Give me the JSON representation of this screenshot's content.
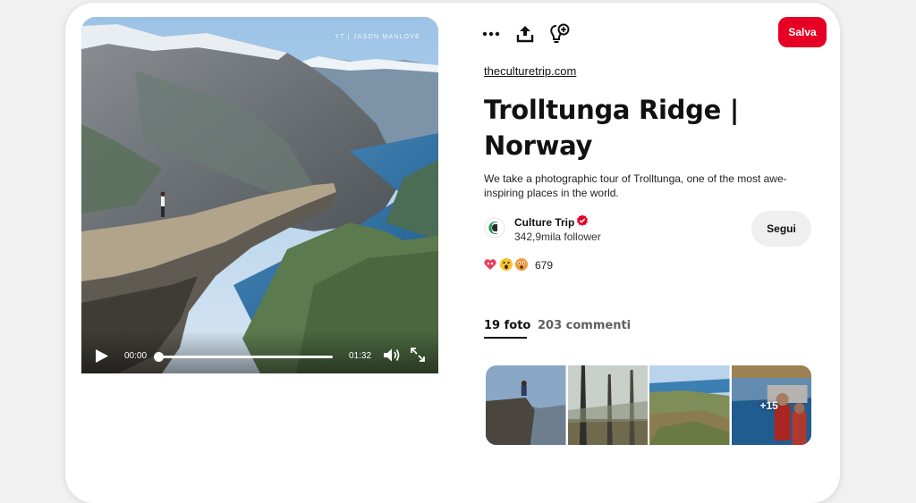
{
  "video": {
    "watermark": "YT | JASON MANLOVE",
    "time_current": "00:00",
    "time_total": "01:32",
    "progress": 0
  },
  "toolbar": {
    "more_icon": "more-horizontal-icon",
    "share_icon": "share-upload-icon",
    "idea_icon": "lightbulb-plus-icon",
    "save_label": "Salva"
  },
  "pin": {
    "source": "theculturetrip.com",
    "title": "Trolltunga Ridge | Norway",
    "description": "We take a photographic tour of Trolltunga, one of the most awe-inspiring places in the world."
  },
  "author": {
    "name": "Culture Trip",
    "followers": "342,9mila follower",
    "follow_label": "Segui"
  },
  "reactions": {
    "icons": [
      "heart-eyes-icon",
      "wow-icon",
      "surprised-icon"
    ],
    "count": "679"
  },
  "tabs": [
    {
      "label": "19 foto",
      "active": true
    },
    {
      "label": "203 commenti",
      "active": false
    }
  ],
  "gallery": {
    "more_label": "+15"
  },
  "colors": {
    "brand_red": "#e60023",
    "button_grey": "#efefef"
  }
}
